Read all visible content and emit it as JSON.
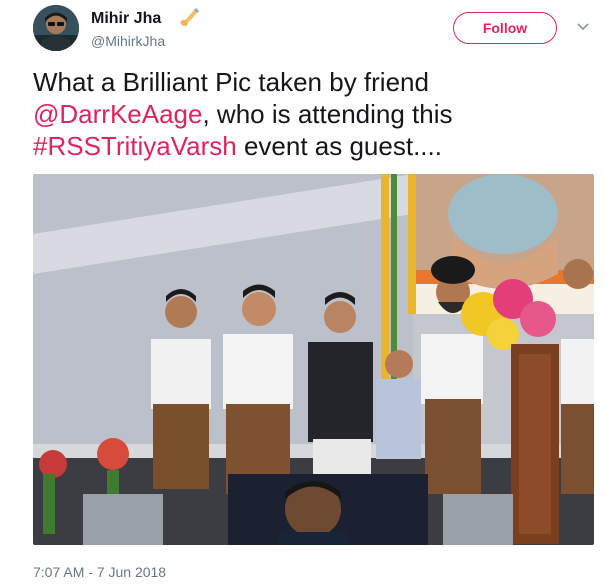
{
  "author": {
    "display_name": "Mihir Jha",
    "username": "@MihirkJha",
    "avatar_icon": "profile-photo",
    "badge_icon": "writing-hand-icon"
  },
  "follow_button": {
    "label": "Follow",
    "color": "#e0245e"
  },
  "menu_icon": "chevron-down-icon",
  "tweet": {
    "text_part1": "What a Brilliant Pic taken by friend ",
    "mention": "@DarrKeAage",
    "text_part2": ", who is attending this ",
    "hashtag": "#RSSTritiyaVarsh",
    "text_part3": " event as guest...."
  },
  "media": {
    "type": "photo"
  },
  "timestamp": "7:07 AM - 7 Jun 2018",
  "colors": {
    "link": "#e0245e",
    "text": "#14171a",
    "muted": "#657786"
  }
}
